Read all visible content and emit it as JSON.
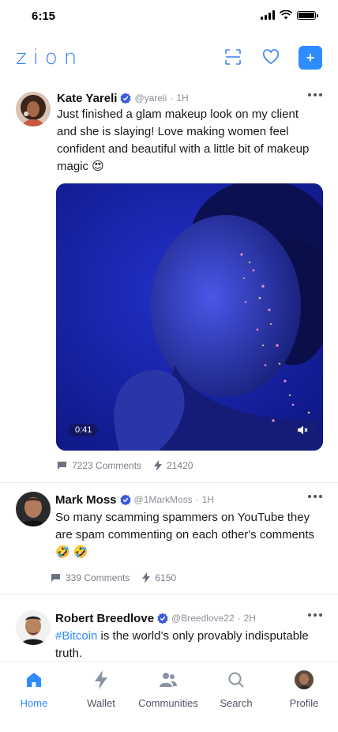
{
  "status_bar": {
    "time": "6:15"
  },
  "header": {
    "logo": "zion",
    "add_label": "+"
  },
  "colors": {
    "accent": "#2d8cff",
    "verified": "#3b5bdb",
    "text_muted": "#8a8f98"
  },
  "posts": [
    {
      "name": "Kate Yareli",
      "handle": "@yareli",
      "time": "1H",
      "text": "Just finished a glam makeup look on my client and she is slaying! Love making women feel confident and beautiful with a little bit of makeup magic 😍",
      "media": {
        "duration": "0:41"
      },
      "comments": "7223 Comments",
      "zaps": "21420"
    },
    {
      "name": "Mark Moss",
      "handle": "@1MarkMoss",
      "time": "1H",
      "text": "So many scamming spammers on YouTube they are spam commenting on each other's comments 🤣 🤣",
      "comments": "339 Comments",
      "zaps": "6150"
    },
    {
      "name": "Robert Breedlove",
      "handle": "@Breedlove22",
      "time": "2H",
      "hashtag": "#Bitcoin",
      "text": " is the world’s only provably indisputable truth."
    }
  ],
  "nav": [
    {
      "label": "Home",
      "icon": "home-icon",
      "active": true
    },
    {
      "label": "Wallet",
      "icon": "lightning-icon"
    },
    {
      "label": "Communities",
      "icon": "people-icon"
    },
    {
      "label": "Search",
      "icon": "search-icon"
    },
    {
      "label": "Profile",
      "icon": "avatar"
    }
  ]
}
